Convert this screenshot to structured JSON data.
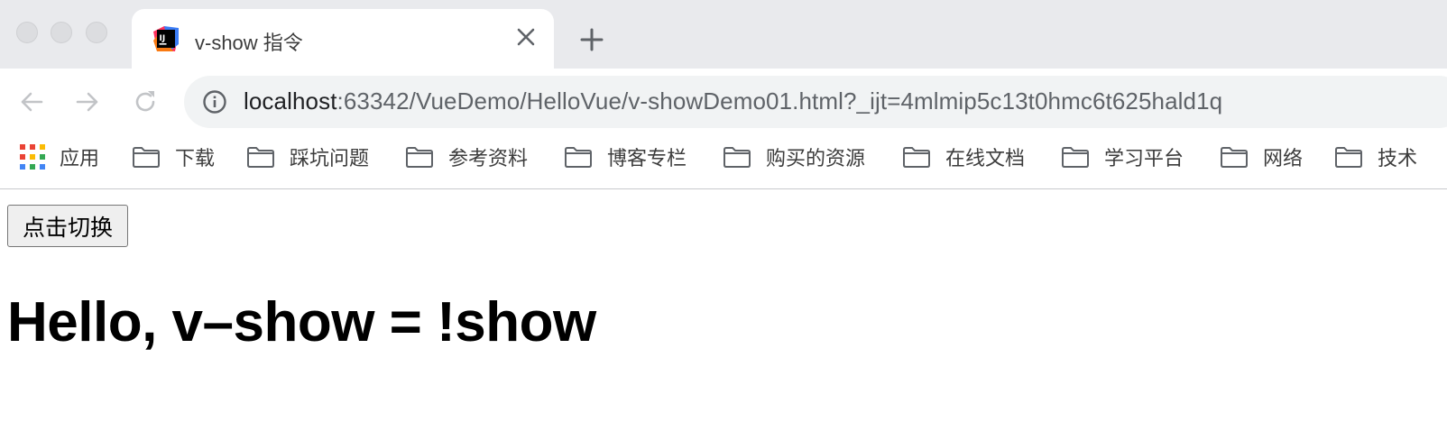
{
  "window": {
    "tab": {
      "title": "v-show 指令",
      "favicon": "intellij-idea-icon"
    }
  },
  "toolbar": {
    "address": {
      "host": "localhost",
      "rest": ":63342/VueDemo/HelloVue/v-showDemo01.html?_ijt=4mlmip5c13t0hmc6t625hald1q"
    }
  },
  "bookmarks": [
    {
      "label": "应用",
      "icon": "apps-grid-icon"
    },
    {
      "label": "下载",
      "icon": "folder-icon"
    },
    {
      "label": "踩坑问题",
      "icon": "folder-icon"
    },
    {
      "label": "参考资料",
      "icon": "folder-icon"
    },
    {
      "label": "博客专栏",
      "icon": "folder-icon"
    },
    {
      "label": "购买的资源",
      "icon": "folder-icon"
    },
    {
      "label": "在线文档",
      "icon": "folder-icon"
    },
    {
      "label": "学习平台",
      "icon": "folder-icon"
    },
    {
      "label": "网络",
      "icon": "folder-icon"
    },
    {
      "label": "技术",
      "icon": "folder-icon"
    }
  ],
  "page": {
    "button_label": "点击切换",
    "heading": "Hello, v–show = !show"
  },
  "colors": {
    "tabstrip": "#e9eaed",
    "omnibox": "#f1f3f4",
    "apps_grid": [
      "#ea4335",
      "#fbbc05",
      "#34a853",
      "#4285f4"
    ]
  }
}
